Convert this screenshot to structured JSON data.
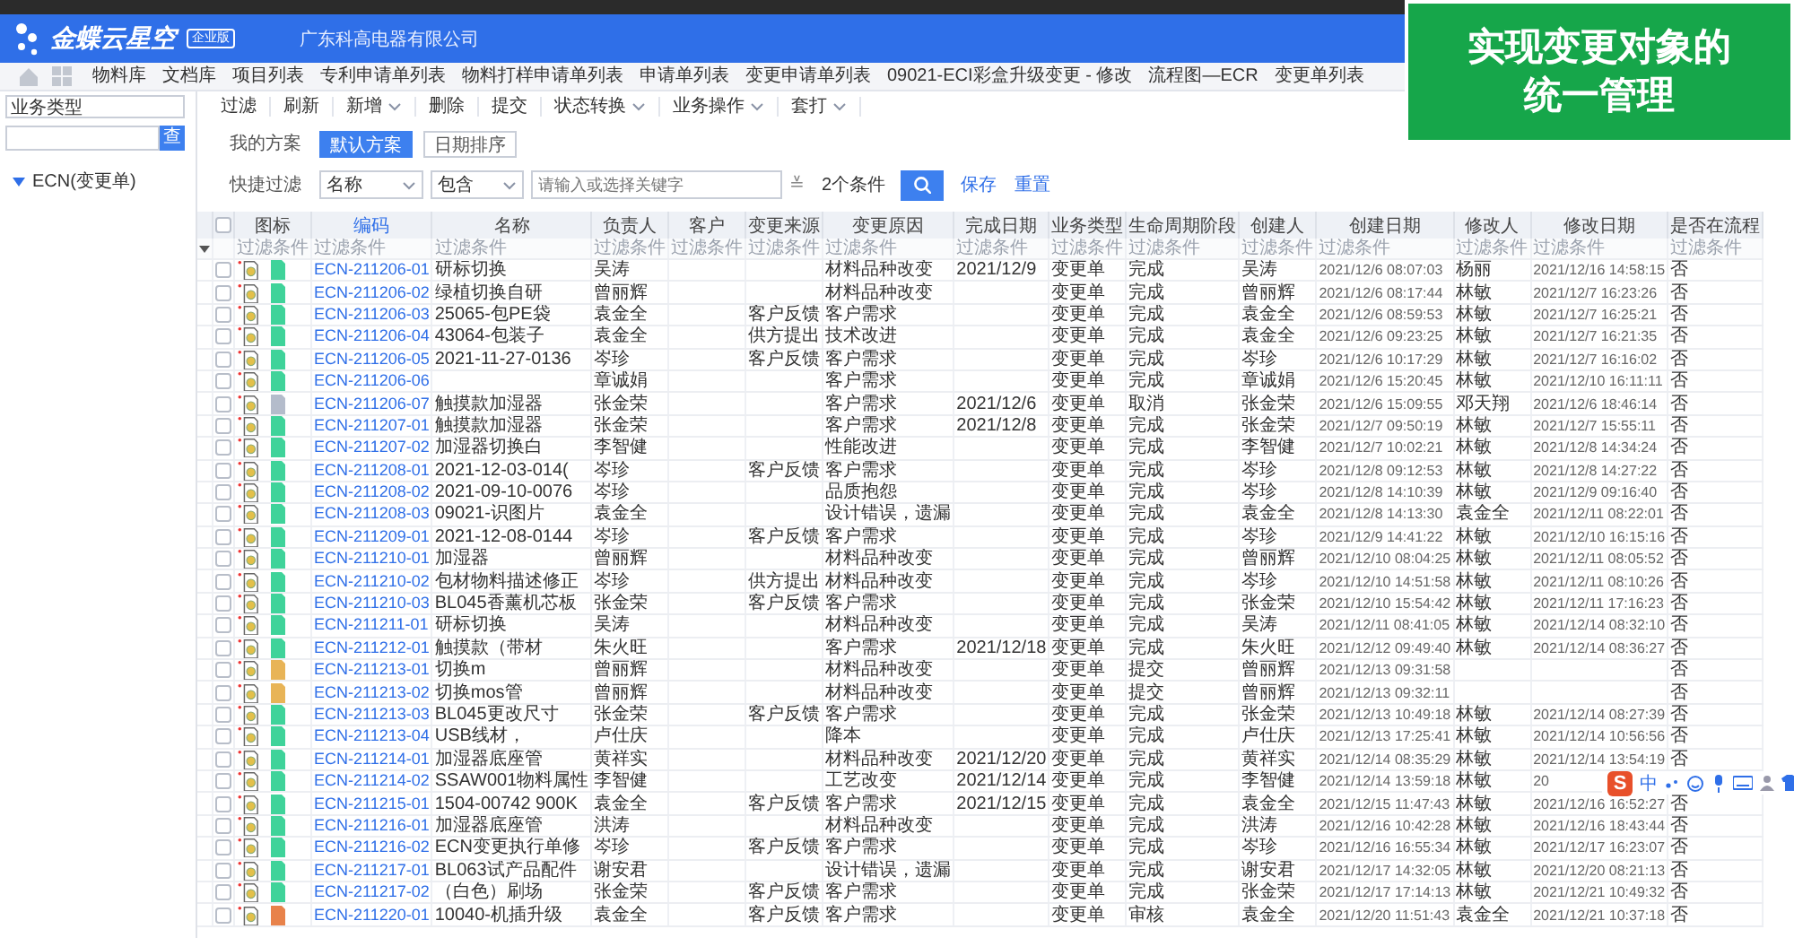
{
  "header": {
    "product": "金蝶云星空",
    "edition": "企业版",
    "company": "广东科高电器有限公司"
  },
  "tabs": [
    {
      "label": "物料库"
    },
    {
      "label": "文档库"
    },
    {
      "label": "项目列表"
    },
    {
      "label": "专利申请单列表"
    },
    {
      "label": "物料打样申请单列表"
    },
    {
      "label": "申请单列表"
    },
    {
      "label": "变更申请单列表"
    },
    {
      "label": "09021-ECI彩盒升级变更 - 修改"
    },
    {
      "label": "流程图—ECR"
    },
    {
      "label": "变更单列表"
    }
  ],
  "sidebar": {
    "type_field": "业务类型",
    "search_button": "查",
    "tree": [
      {
        "label": "ECN(变更单)",
        "expanded": true
      }
    ]
  },
  "toolbar": [
    {
      "label": "过滤",
      "dropdown": false
    },
    {
      "label": "刷新",
      "dropdown": false
    },
    {
      "label": "新增",
      "dropdown": true
    },
    {
      "label": "删除",
      "dropdown": false
    },
    {
      "label": "提交",
      "dropdown": false
    },
    {
      "label": "状态转换",
      "dropdown": true
    },
    {
      "label": "业务操作",
      "dropdown": true
    },
    {
      "label": "套打",
      "dropdown": true
    }
  ],
  "schemes": {
    "label": "我的方案",
    "items": [
      {
        "label": "默认方案",
        "selected": true
      },
      {
        "label": "日期排序",
        "selected": false
      }
    ]
  },
  "quick_filter": {
    "label": "快捷过滤",
    "field": "名称",
    "operator": "包含",
    "placeholder": "请输入或选择关键字",
    "expand": "≚",
    "condition_count": "2个条件",
    "save": "保存",
    "reset": "重置"
  },
  "table": {
    "select_all_checked": false,
    "columns": [
      {
        "label": "图标",
        "sorted": false,
        "filter": "过滤条件"
      },
      {
        "label": "编码",
        "sorted": true,
        "filter": "过滤条件"
      },
      {
        "label": "名称",
        "sorted": false,
        "filter": "过滤条件"
      },
      {
        "label": "负责人",
        "sorted": false,
        "filter": "过滤条件"
      },
      {
        "label": "客户",
        "sorted": false,
        "filter": "过滤条件"
      },
      {
        "label": "变更来源",
        "sorted": false,
        "filter": "过滤条件"
      },
      {
        "label": "变更原因",
        "sorted": false,
        "filter": "过滤条件"
      },
      {
        "label": "完成日期",
        "sorted": false,
        "filter": "过滤条件"
      },
      {
        "label": "业务类型",
        "sorted": false,
        "filter": "过滤条件"
      },
      {
        "label": "生命周期阶段",
        "sorted": false,
        "filter": "过滤条件"
      },
      {
        "label": "创建人",
        "sorted": false,
        "filter": "过滤条件"
      },
      {
        "label": "创建日期",
        "sorted": false,
        "filter": "过滤条件"
      },
      {
        "label": "修改人",
        "sorted": false,
        "filter": "过滤条件"
      },
      {
        "label": "修改日期",
        "sorted": false,
        "filter": "过滤条件"
      },
      {
        "label": "是否在流程",
        "sorted": false,
        "filter": "过滤条件"
      }
    ],
    "rows": [
      {
        "checked": false,
        "color": "#3fd39a",
        "cells": [
          "",
          "ECN-211206-01",
          "研标切换",
          "吴涛",
          "",
          "",
          "材料品种改变",
          "2021/12/9",
          "变更单",
          "完成",
          "吴涛",
          "2021/12/6 08:07:03",
          "杨丽",
          "2021/12/16 14:58:15",
          "否"
        ]
      },
      {
        "checked": false,
        "color": "#3fd39a",
        "cells": [
          "",
          "ECN-211206-02",
          "绿植切换自研",
          "曾丽辉",
          "",
          "",
          "材料品种改变",
          "",
          "变更单",
          "完成",
          "曾丽辉",
          "2021/12/6 08:17:44",
          "林敏",
          "2021/12/7 16:23:26",
          "否"
        ]
      },
      {
        "checked": false,
        "color": "#3fd39a",
        "cells": [
          "",
          "ECN-211206-03",
          "25065-包PE袋",
          "袁金全",
          "",
          "客户反馈",
          "客户需求",
          "",
          "变更单",
          "完成",
          "袁金全",
          "2021/12/6 08:59:53",
          "林敏",
          "2021/12/7 16:25:21",
          "否"
        ]
      },
      {
        "checked": false,
        "color": "#3fd39a",
        "cells": [
          "",
          "ECN-211206-04",
          "43064-包装子",
          "袁金全",
          "",
          "供方提出",
          "技术改进",
          "",
          "变更单",
          "完成",
          "袁金全",
          "2021/12/6 09:23:25",
          "林敏",
          "2021/12/7 16:21:35",
          "否"
        ]
      },
      {
        "checked": false,
        "color": "#3fd39a",
        "cells": [
          "",
          "ECN-211206-05",
          "2021-11-27-0136",
          "岑珍",
          "",
          "客户反馈",
          "客户需求",
          "",
          "变更单",
          "完成",
          "岑珍",
          "2021/12/6 10:17:29",
          "林敏",
          "2021/12/7 16:16:02",
          "否"
        ]
      },
      {
        "checked": false,
        "color": "#3fd39a",
        "cells": [
          "",
          "ECN-211206-06",
          "",
          "章诚娟",
          "",
          "",
          "客户需求",
          "",
          "变更单",
          "完成",
          "章诚娟",
          "2021/12/6 15:20:45",
          "林敏",
          "2021/12/10 16:11:11",
          "否"
        ]
      },
      {
        "checked": false,
        "color": "#b4bccb",
        "cells": [
          "",
          "ECN-211206-07",
          "触摸款加湿器",
          "张金荣",
          "",
          "",
          "客户需求",
          "2021/12/6",
          "变更单",
          "取消",
          "张金荣",
          "2021/12/6 15:09:55",
          "邓天翔",
          "2021/12/6 18:46:14",
          "否"
        ]
      },
      {
        "checked": false,
        "color": "#3fd39a",
        "cells": [
          "",
          "ECN-211207-01",
          "触摸款加湿器",
          "张金荣",
          "",
          "",
          "客户需求",
          "2021/12/8",
          "变更单",
          "完成",
          "张金荣",
          "2021/12/7 09:50:19",
          "林敏",
          "2021/12/7 15:55:11",
          "否"
        ]
      },
      {
        "checked": false,
        "color": "#3fd39a",
        "cells": [
          "",
          "ECN-211207-02",
          "加湿器切换白",
          "李智健",
          "",
          "",
          "性能改进",
          "",
          "变更单",
          "完成",
          "李智健",
          "2021/12/7 10:02:21",
          "林敏",
          "2021/12/8 14:34:24",
          "否"
        ]
      },
      {
        "checked": false,
        "color": "#3fd39a",
        "cells": [
          "",
          "ECN-211208-01",
          "2021-12-03-014(",
          "岑珍",
          "",
          "客户反馈",
          "客户需求",
          "",
          "变更单",
          "完成",
          "岑珍",
          "2021/12/8 09:12:53",
          "林敏",
          "2021/12/8 14:27:22",
          "否"
        ]
      },
      {
        "checked": false,
        "color": "#3fd39a",
        "cells": [
          "",
          "ECN-211208-02",
          "2021-09-10-0076",
          "岑珍",
          "",
          "",
          "品质抱怨",
          "",
          "变更单",
          "完成",
          "岑珍",
          "2021/12/8 14:10:39",
          "林敏",
          "2021/12/9 09:16:40",
          "否"
        ]
      },
      {
        "checked": false,
        "color": "#3fd39a",
        "cells": [
          "",
          "ECN-211208-03",
          "09021-识图片",
          "袁金全",
          "",
          "",
          "设计错误，遗漏",
          "",
          "变更单",
          "完成",
          "袁金全",
          "2021/12/8 14:13:30",
          "袁金全",
          "2021/12/11 08:22:01",
          "否"
        ]
      },
      {
        "checked": false,
        "color": "#3fd39a",
        "cells": [
          "",
          "ECN-211209-01",
          "2021-12-08-0144",
          "岑珍",
          "",
          "客户反馈",
          "客户需求",
          "",
          "变更单",
          "完成",
          "岑珍",
          "2021/12/9 14:41:22",
          "林敏",
          "2021/12/10 16:15:16",
          "否"
        ]
      },
      {
        "checked": false,
        "color": "#3fd39a",
        "cells": [
          "",
          "ECN-211210-01",
          "加湿器",
          "曾丽辉",
          "",
          "",
          "材料品种改变",
          "",
          "变更单",
          "完成",
          "曾丽辉",
          "2021/12/10 08:04:25",
          "林敏",
          "2021/12/11 08:05:52",
          "否"
        ]
      },
      {
        "checked": false,
        "color": "#3fd39a",
        "cells": [
          "",
          "ECN-211210-02",
          "包材物料描述修正",
          "岑珍",
          "",
          "供方提出",
          "材料品种改变",
          "",
          "变更单",
          "完成",
          "岑珍",
          "2021/12/10 14:51:58",
          "林敏",
          "2021/12/11 08:10:26",
          "否"
        ]
      },
      {
        "checked": false,
        "color": "#3fd39a",
        "cells": [
          "",
          "ECN-211210-03",
          "BL045香薰机芯板",
          "张金荣",
          "",
          "客户反馈",
          "客户需求",
          "",
          "变更单",
          "完成",
          "张金荣",
          "2021/12/10 15:54:42",
          "林敏",
          "2021/12/11 17:16:23",
          "否"
        ]
      },
      {
        "checked": false,
        "color": "#3fd39a",
        "cells": [
          "",
          "ECN-211211-01",
          "研标切换",
          "吴涛",
          "",
          "",
          "材料品种改变",
          "",
          "变更单",
          "完成",
          "吴涛",
          "2021/12/11 08:41:05",
          "林敏",
          "2021/12/14 08:32:10",
          "否"
        ]
      },
      {
        "checked": false,
        "color": "#3fd39a",
        "cells": [
          "",
          "ECN-211212-01",
          "触摸款（带材",
          "朱火旺",
          "",
          "",
          "客户需求",
          "2021/12/18",
          "变更单",
          "完成",
          "朱火旺",
          "2021/12/12 09:49:40",
          "林敏",
          "2021/12/14 08:36:27",
          "否"
        ]
      },
      {
        "checked": false,
        "color": "#e8b457",
        "cells": [
          "",
          "ECN-211213-01",
          "切换m",
          "曾丽辉",
          "",
          "",
          "材料品种改变",
          "",
          "变更单",
          "提交",
          "曾丽辉",
          "2021/12/13 09:31:58",
          "",
          "",
          "否"
        ]
      },
      {
        "checked": false,
        "color": "#e8b457",
        "cells": [
          "",
          "ECN-211213-02",
          "切换mos管",
          "曾丽辉",
          "",
          "",
          "材料品种改变",
          "",
          "变更单",
          "提交",
          "曾丽辉",
          "2021/12/13 09:32:11",
          "",
          "",
          "否"
        ]
      },
      {
        "checked": false,
        "color": "#3fd39a",
        "cells": [
          "",
          "ECN-211213-03",
          "BL045更改尺寸",
          "张金荣",
          "",
          "客户反馈",
          "客户需求",
          "",
          "变更单",
          "完成",
          "张金荣",
          "2021/12/13 10:49:18",
          "林敏",
          "2021/12/14 08:27:39",
          "否"
        ]
      },
      {
        "checked": false,
        "color": "#3fd39a",
        "cells": [
          "",
          "ECN-211213-04",
          "USB线材，",
          "卢仕庆",
          "",
          "",
          "降本",
          "",
          "变更单",
          "完成",
          "卢仕庆",
          "2021/12/13 17:25:41",
          "林敏",
          "2021/12/14 10:56:56",
          "否"
        ]
      },
      {
        "checked": false,
        "color": "#3fd39a",
        "cells": [
          "",
          "ECN-211214-01",
          "加湿器底座管",
          "黄祥实",
          "",
          "",
          "材料品种改变",
          "2021/12/20",
          "变更单",
          "完成",
          "黄祥实",
          "2021/12/14 08:35:29",
          "林敏",
          "2021/12/14 13:54:19",
          "否"
        ]
      },
      {
        "checked": false,
        "color": "#3fd39a",
        "cells": [
          "",
          "ECN-211214-02",
          "SSAW001物料属性",
          "李智健",
          "",
          "",
          "工艺改变",
          "2021/12/14",
          "变更单",
          "完成",
          "李智健",
          "2021/12/14 13:59:18",
          "林敏",
          "20",
          ""
        ]
      },
      {
        "checked": false,
        "color": "#3fd39a",
        "cells": [
          "",
          "ECN-211215-01",
          "1504-00742 900K",
          "袁金全",
          "",
          "客户反馈",
          "客户需求",
          "2021/12/15",
          "变更单",
          "完成",
          "袁金全",
          "2021/12/15 11:47:43",
          "林敏",
          "2021/12/16 16:52:27",
          "否"
        ]
      },
      {
        "checked": false,
        "color": "#3fd39a",
        "cells": [
          "",
          "ECN-211216-01",
          "加湿器底座管",
          "洪涛",
          "",
          "",
          "材料品种改变",
          "",
          "变更单",
          "完成",
          "洪涛",
          "2021/12/16 10:42:28",
          "林敏",
          "2021/12/16 18:43:44",
          "否"
        ]
      },
      {
        "checked": false,
        "color": "#3fd39a",
        "cells": [
          "",
          "ECN-211216-02",
          "ECN变更执行单修",
          "岑珍",
          "",
          "客户反馈",
          "客户需求",
          "",
          "变更单",
          "完成",
          "岑珍",
          "2021/12/16 16:55:34",
          "林敏",
          "2021/12/17 16:23:07",
          "否"
        ]
      },
      {
        "checked": false,
        "color": "#3fd39a",
        "cells": [
          "",
          "ECN-211217-01",
          "BL063试产品配件",
          "谢安君",
          "",
          "",
          "设计错误，遗漏",
          "",
          "变更单",
          "完成",
          "谢安君",
          "2021/12/17 14:32:05",
          "林敏",
          "2021/12/20 08:21:13",
          "否"
        ]
      },
      {
        "checked": false,
        "color": "#3fd39a",
        "cells": [
          "",
          "ECN-211217-02",
          "（白色）刷场",
          "张金荣",
          "",
          "客户反馈",
          "客户需求",
          "",
          "变更单",
          "完成",
          "张金荣",
          "2021/12/17 17:14:13",
          "林敏",
          "2021/12/21 10:49:32",
          "否"
        ]
      },
      {
        "checked": false,
        "color": "#e8824a",
        "cells": [
          "",
          "ECN-211220-01",
          "10040-机插升级",
          "袁金全",
          "",
          "客户反馈",
          "客户需求",
          "",
          "变更单",
          "审核",
          "袁金全",
          "2021/12/20 11:51:43",
          "袁金全",
          "2021/12/21 10:37:18",
          "否"
        ]
      }
    ]
  },
  "ime_bar": {
    "logo": "S",
    "mode": "中"
  },
  "banner": {
    "lines": [
      "实现变更对象的",
      "统一管理"
    ]
  }
}
